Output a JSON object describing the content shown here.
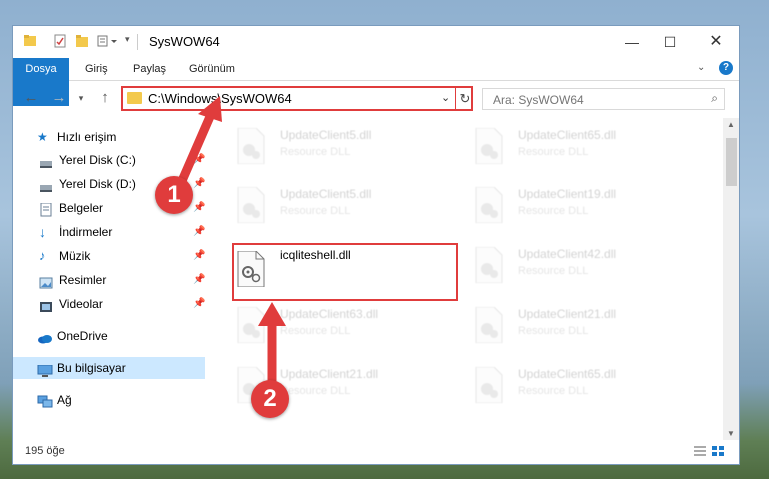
{
  "window": {
    "title": "SysWOW64"
  },
  "ribbon": {
    "tabs": [
      "Dosya",
      "Giriş",
      "Paylaş",
      "Görünüm"
    ]
  },
  "address": {
    "path": "C:\\Windows\\SysWOW64"
  },
  "search": {
    "placeholder": "Ara: SysWOW64"
  },
  "sidebar": {
    "items": [
      {
        "label": "Hızlı erişim",
        "icon": "star-icon"
      },
      {
        "label": "Yerel Disk (C:)",
        "icon": "drive-icon",
        "pinned": true
      },
      {
        "label": "Yerel Disk (D:)",
        "icon": "drive-icon",
        "pinned": true
      },
      {
        "label": "Belgeler",
        "icon": "documents-icon",
        "pinned": true
      },
      {
        "label": "İndirmeler",
        "icon": "download-icon",
        "pinned": true
      },
      {
        "label": "Müzik",
        "icon": "music-icon",
        "pinned": true
      },
      {
        "label": "Resimler",
        "icon": "pictures-icon",
        "pinned": true
      },
      {
        "label": "Videolar",
        "icon": "videos-icon",
        "pinned": true
      },
      {
        "label": "OneDrive",
        "icon": "cloud-icon"
      },
      {
        "label": "Bu bilgisayar",
        "icon": "computer-icon",
        "selected": true
      },
      {
        "label": "Ağ",
        "icon": "network-icon"
      }
    ]
  },
  "files": {
    "row1_left": {
      "name": "UpdateClient5.dll",
      "desc": "Resource DLL"
    },
    "row1_right": {
      "name": "UpdateClient65.dll",
      "desc": "Resource DLL"
    },
    "row2_left": {
      "name": "UpdateClient5.dll",
      "desc": "Resource DLL"
    },
    "row2_right": {
      "name": "UpdateClient19.dll",
      "desc": "Resource DLL"
    },
    "highlight": {
      "name": "icqliteshell.dll"
    },
    "row3_right": {
      "name": "UpdateClient42.dll",
      "desc": "Resource DLL"
    },
    "row4_left": {
      "name": "UpdateClient63.dll",
      "desc": "Resource DLL"
    },
    "row4_right": {
      "name": "UpdateClient21.dll",
      "desc": "Resource DLL"
    },
    "row5_left": {
      "name": "UpdateClient21.dll",
      "desc": "Resource DLL"
    },
    "row5_right": {
      "name": "UpdateClient65.dll",
      "desc": "Resource DLL"
    }
  },
  "status": {
    "count": "195 öğe"
  },
  "annotations": {
    "badge1": "1",
    "badge2": "2"
  },
  "colors": {
    "accent": "#1979ca",
    "annotation": "#e03c3c",
    "selection": "#cce8ff"
  }
}
